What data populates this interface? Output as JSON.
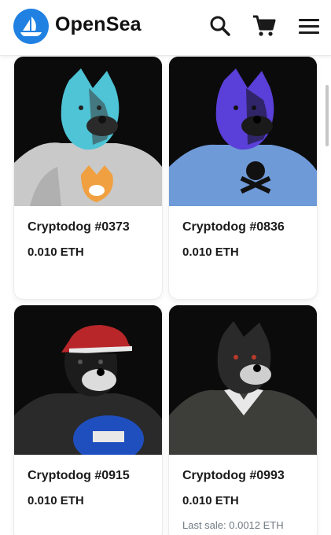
{
  "header": {
    "brand": "OpenSea",
    "logo_icon": "opensea-boat-icon",
    "search_icon": "search-icon",
    "cart_icon": "cart-icon",
    "menu_icon": "hamburger-menu-icon",
    "accent_color": "#2081E2"
  },
  "items": [
    {
      "name": "Cryptodog #0373",
      "price": "0.010 ETH",
      "last_sale": ""
    },
    {
      "name": "Cryptodog #0836",
      "price": "0.010 ETH",
      "last_sale": ""
    },
    {
      "name": "Cryptodog #0915",
      "price": "0.010 ETH",
      "last_sale": ""
    },
    {
      "name": "Cryptodog #0993",
      "price": "0.010 ETH",
      "last_sale": "Last sale: 0.0012 ETH"
    }
  ],
  "colors": {
    "dog_0373": "#4ec4d6",
    "dog_0836": "#5a3fd8",
    "dog_0915": "#1c1c1c",
    "dog_0993": "#2a2a2a"
  }
}
